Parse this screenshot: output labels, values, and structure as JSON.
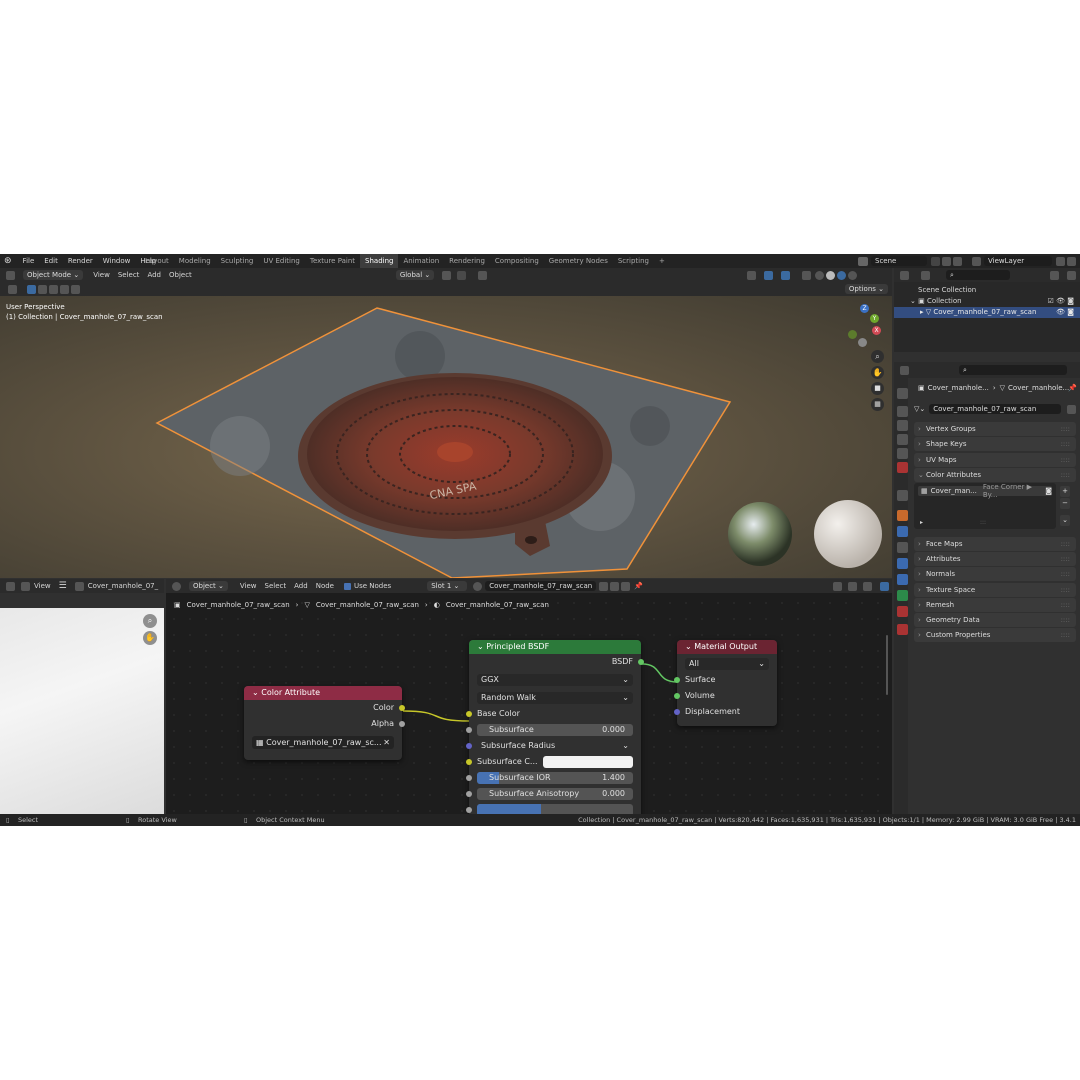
{
  "menu": [
    "File",
    "Edit",
    "Render",
    "Window",
    "Help"
  ],
  "workspaces": [
    {
      "label": "Layout",
      "active": false
    },
    {
      "label": "Modeling",
      "active": false
    },
    {
      "label": "Sculpting",
      "active": false
    },
    {
      "label": "UV Editing",
      "active": false
    },
    {
      "label": "Texture Paint",
      "active": false
    },
    {
      "label": "Shading",
      "active": true
    },
    {
      "label": "Animation",
      "active": false
    },
    {
      "label": "Rendering",
      "active": false
    },
    {
      "label": "Compositing",
      "active": false
    },
    {
      "label": "Geometry Nodes",
      "active": false
    },
    {
      "label": "Scripting",
      "active": false
    }
  ],
  "add_tab": "+",
  "scene": "Scene",
  "view_layer": "ViewLayer",
  "viewport_header": {
    "mode": "Object Mode",
    "menus": [
      "View",
      "Select",
      "Add",
      "Object"
    ],
    "orientation": "Global",
    "options": "Options"
  },
  "viewport": {
    "perspective": "User Perspective",
    "collection_info": "(1) Collection | Cover_manhole_07_raw_scan",
    "gizmo": {
      "z": "Z",
      "y": "Y",
      "x": "X"
    },
    "manhole_text": "CNA SPA"
  },
  "outliner": {
    "scene_collection": "Scene Collection",
    "collection": "Collection",
    "object": "Cover_manhole_07_raw_scan"
  },
  "properties": {
    "breadcrumb_1": "Cover_manhole...",
    "breadcrumb_2": "Cover_manhole...",
    "mesh_name": "Cover_manhole_07_raw_scan",
    "panels_top": [
      "Vertex Groups",
      "Shape Keys",
      "UV Maps",
      "Color Attributes"
    ],
    "color_attr_item": "Cover_man...",
    "color_attr_domain": "Face Corner ▶ By...",
    "panels_bottom": [
      "Face Maps",
      "Attributes",
      "Normals",
      "Texture Space",
      "Remesh",
      "Geometry Data",
      "Custom Properties"
    ]
  },
  "image_editor": {
    "view": "View",
    "image": "Cover_manhole_07_"
  },
  "node_header": {
    "type": "Object",
    "menus": [
      "View",
      "Select",
      "Add",
      "Node"
    ],
    "use_nodes": "Use Nodes",
    "slot": "Slot 1",
    "material": "Cover_manhole_07_raw_scan"
  },
  "node_breadcrumb": [
    "Cover_manhole_07_raw_scan",
    "Cover_manhole_07_raw_scan",
    "Cover_manhole_07_raw_scan"
  ],
  "nodes": {
    "color_attribute": {
      "title": "Color Attribute",
      "out_color": "Color",
      "out_alpha": "Alpha",
      "layer": "Cover_manhole_07_raw_sc..."
    },
    "principled": {
      "title": "Principled BSDF",
      "out": "BSDF",
      "distribution": "GGX",
      "subsurface_method": "Random Walk",
      "base_color": "Base Color",
      "subsurface": "Subsurface",
      "subsurface_value": "0.000",
      "subsurface_radius": "Subsurface Radius",
      "subsurface_color": "Subsurface C...",
      "subsurface_ior": "Subsurface IOR",
      "subsurface_ior_value": "1.400",
      "subsurface_aniso": "Subsurface Anisotropy",
      "subsurface_aniso_value": "0.000"
    },
    "material_output": {
      "title": "Material Output",
      "target": "All",
      "surface": "Surface",
      "volume": "Volume",
      "displacement": "Displacement"
    }
  },
  "status": {
    "select": "Select",
    "rotate": "Rotate View",
    "context": "Object Context Menu",
    "stats": "Collection | Cover_manhole_07_raw_scan | Verts:820,442 | Faces:1,635,931 | Tris:1,635,931 | Objects:1/1 | Memory: 2.99 GiB | VRAM: 3.0 GiB Free | 3.4.1"
  },
  "colors": {
    "selection_orange": "#f0923a",
    "shader_green": "#2c7a3a",
    "input_red": "#8e2c45",
    "output_red": "#6b2432",
    "socket_yellow": "#c7c729",
    "socket_grey": "#a1a1a1",
    "socket_green": "#63c763",
    "socket_purple": "#6363c7"
  }
}
